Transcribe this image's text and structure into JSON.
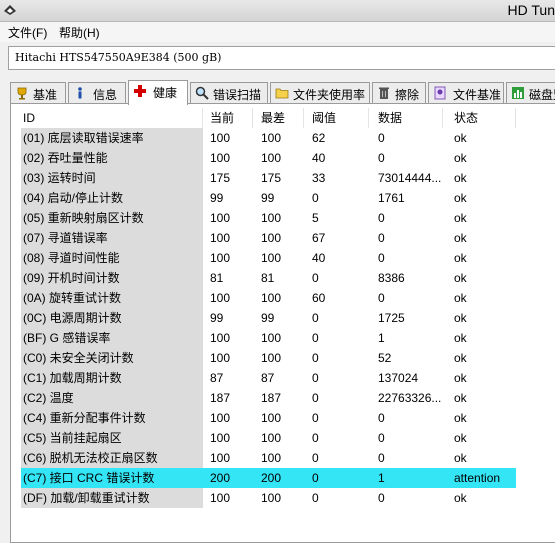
{
  "window": {
    "title": "HD Tun"
  },
  "menu": {
    "file": "文件(F)",
    "help": "帮助(H)"
  },
  "drive": {
    "label": "Hitachi HTS547550A9E384 (500 gB)"
  },
  "tabs": [
    {
      "label": "基准",
      "icon": "gold-cup-icon"
    },
    {
      "label": "信息",
      "icon": "info-icon"
    },
    {
      "label": "健康",
      "icon": "red-cross-icon",
      "active": true
    },
    {
      "label": "错误扫描",
      "icon": "magnifier-icon"
    },
    {
      "label": "文件夹使用率",
      "icon": "folder-icon"
    },
    {
      "label": "擦除",
      "icon": "trash-icon"
    },
    {
      "label": "文件基准",
      "icon": "file-benchmark-icon"
    },
    {
      "label": "磁盘监",
      "icon": "disk-monitor-icon"
    }
  ],
  "columns": [
    "ID",
    "当前",
    "最差",
    "阈值",
    "数据",
    "状态"
  ],
  "rows": [
    [
      "(01) 底层读取错误速率",
      "100",
      "100",
      "62",
      "0",
      "ok"
    ],
    [
      "(02) 吞吐量性能",
      "100",
      "100",
      "40",
      "0",
      "ok"
    ],
    [
      "(03) 运转时间",
      "175",
      "175",
      "33",
      "73014444...",
      "ok"
    ],
    [
      "(04) 启动/停止计数",
      "99",
      "99",
      "0",
      "1761",
      "ok"
    ],
    [
      "(05) 重新映射扇区计数",
      "100",
      "100",
      "5",
      "0",
      "ok"
    ],
    [
      "(07) 寻道错误率",
      "100",
      "100",
      "67",
      "0",
      "ok"
    ],
    [
      "(08) 寻道时间性能",
      "100",
      "100",
      "40",
      "0",
      "ok"
    ],
    [
      "(09) 开机时间计数",
      "81",
      "81",
      "0",
      "8386",
      "ok"
    ],
    [
      "(0A) 旋转重试计数",
      "100",
      "100",
      "60",
      "0",
      "ok"
    ],
    [
      "(0C) 电源周期计数",
      "99",
      "99",
      "0",
      "1725",
      "ok"
    ],
    [
      "(BF) G 感错误率",
      "100",
      "100",
      "0",
      "1",
      "ok"
    ],
    [
      "(C0) 未安全关闭计数",
      "100",
      "100",
      "0",
      "52",
      "ok"
    ],
    [
      "(C1) 加载周期计数",
      "87",
      "87",
      "0",
      "137024",
      "ok"
    ],
    [
      "(C2) 温度",
      "187",
      "187",
      "0",
      "22763326...",
      "ok"
    ],
    [
      "(C4) 重新分配事件计数",
      "100",
      "100",
      "0",
      "0",
      "ok"
    ],
    [
      "(C5) 当前挂起扇区",
      "100",
      "100",
      "0",
      "0",
      "ok"
    ],
    [
      "(C6) 脱机无法校正扇区数",
      "100",
      "100",
      "0",
      "0",
      "ok"
    ],
    [
      "(C7) 接口 CRC 错误计数",
      "200",
      "200",
      "0",
      "1",
      "attention"
    ],
    [
      "(DF) 加载/卸载重试计数",
      "100",
      "100",
      "0",
      "0",
      "ok"
    ]
  ],
  "highlight_color": "#33e5f5"
}
